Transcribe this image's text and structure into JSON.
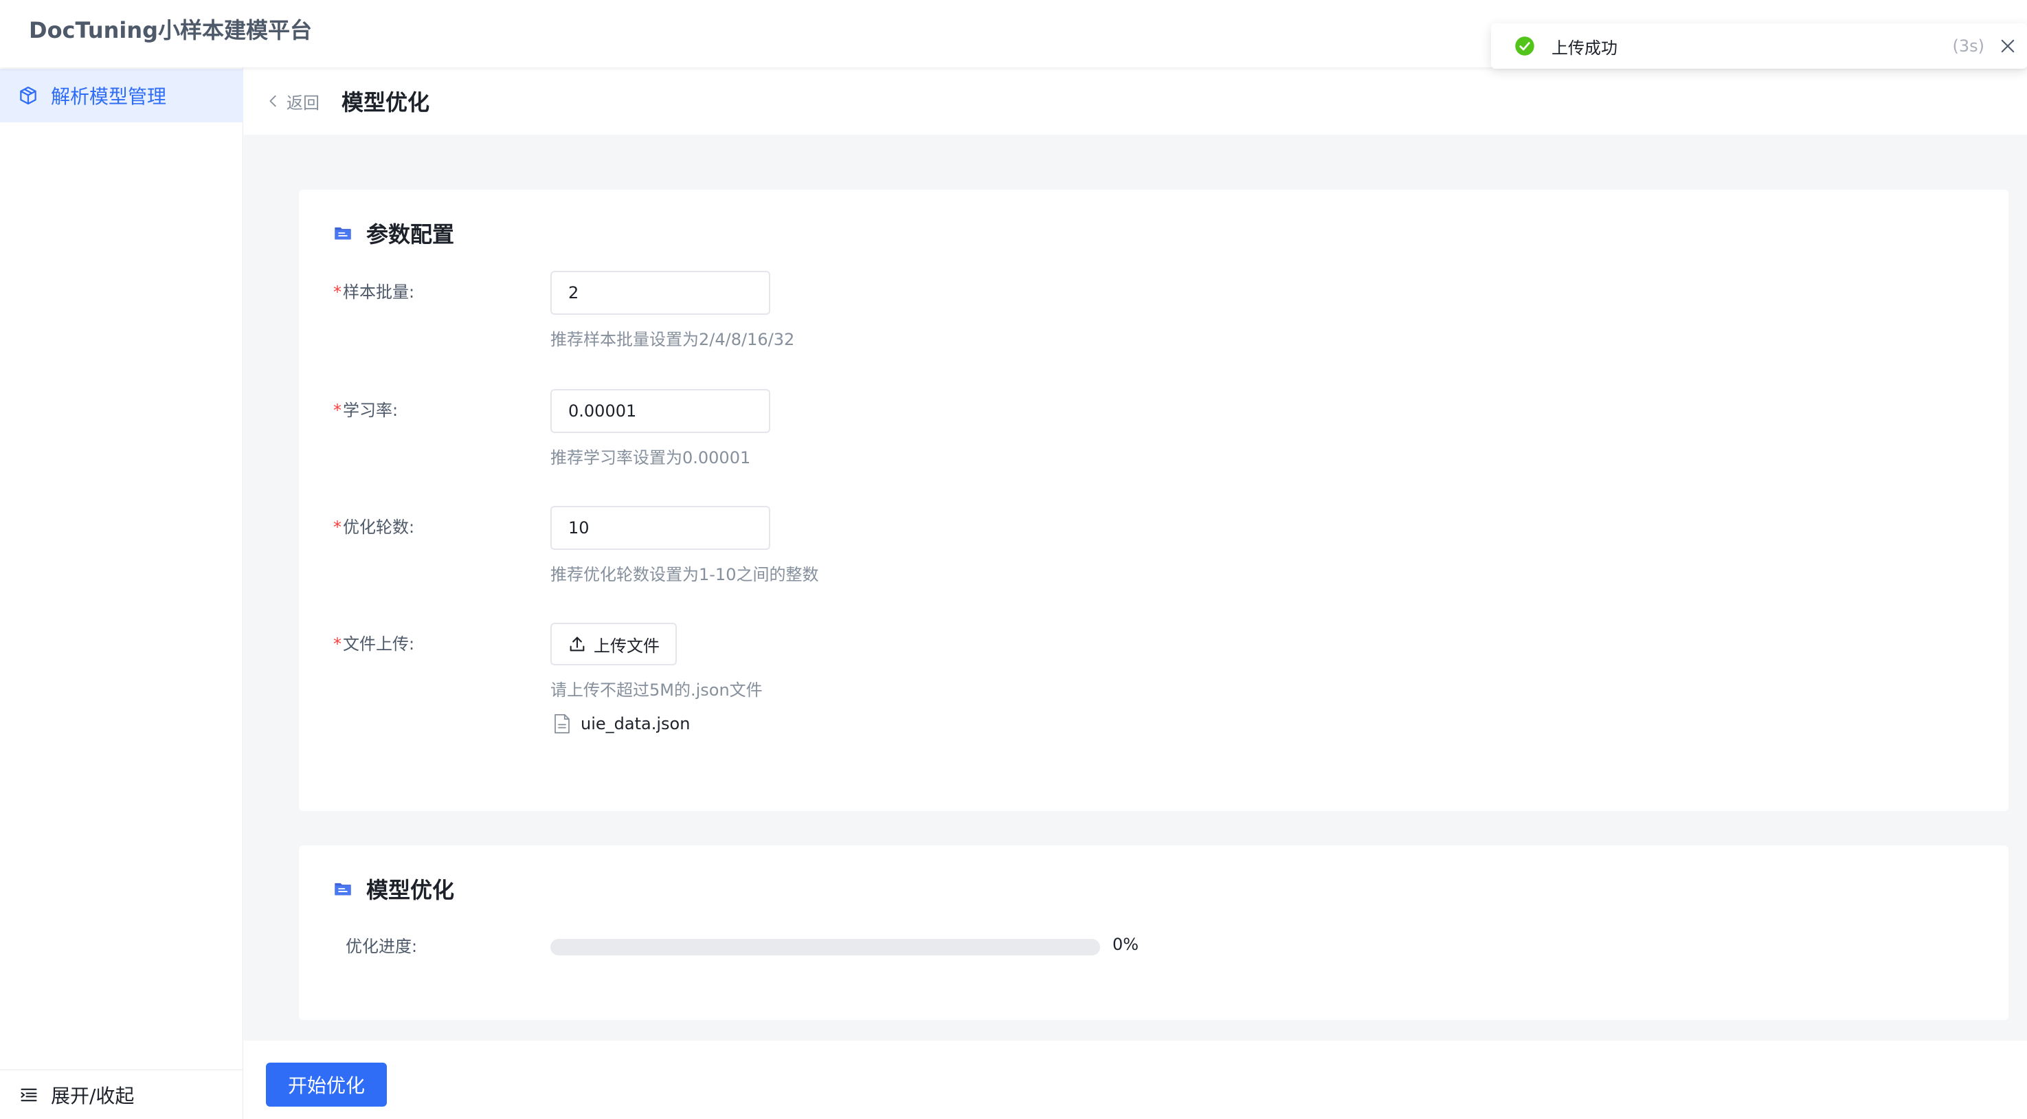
{
  "app": {
    "title": "DocTuning小样本建模平台"
  },
  "sidebar": {
    "items": [
      {
        "label": "解析模型管理",
        "icon": "cube-icon",
        "active": true
      }
    ],
    "footer_label": "展开/收起"
  },
  "page_header": {
    "back_label": "返回",
    "title": "模型优化"
  },
  "params_card": {
    "title": "参数配置",
    "batch": {
      "label": "样本批量:",
      "value": "2",
      "hint": "推荐样本批量设置为2/4/8/16/32"
    },
    "lr": {
      "label": "学习率:",
      "value": "0.00001",
      "hint": "推荐学习率设置为0.00001"
    },
    "epochs": {
      "label": "优化轮数:",
      "value": "10",
      "hint": "推荐优化轮数设置为1-10之间的整数"
    },
    "upload": {
      "label": "文件上传:",
      "button_label": "上传文件",
      "hint": "请上传不超过5M的.json文件",
      "file_name": "uie_data.json"
    }
  },
  "optimize_card": {
    "title": "模型优化",
    "progress_label": "优化进度:",
    "progress_percent": 0,
    "progress_text": "0%"
  },
  "actions": {
    "start_label": "开始优化"
  },
  "toast": {
    "message": "上传成功",
    "countdown": "(3s)"
  },
  "colors": {
    "primary": "#2f6df6",
    "required": "#f53f3f",
    "success": "#52c41a"
  }
}
